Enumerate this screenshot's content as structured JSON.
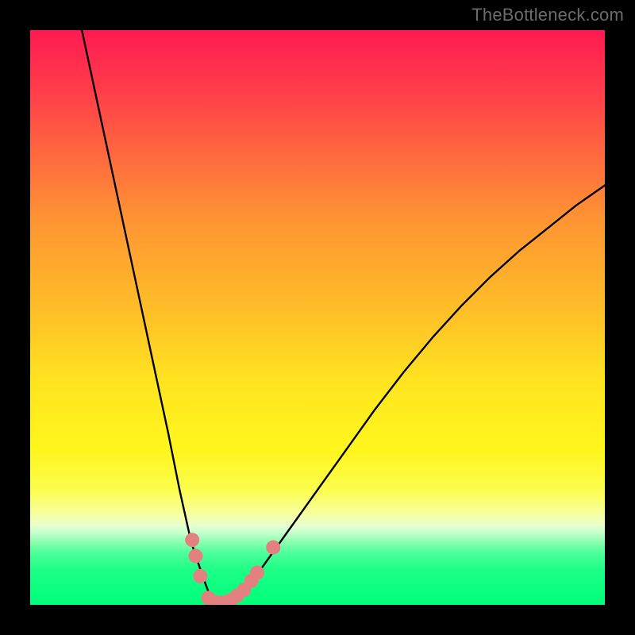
{
  "watermark": "TheBottleneck.com",
  "colors": {
    "background": "#000000",
    "gradient_top": "#ff1a52",
    "gradient_mid": "#ffe61f",
    "gradient_bottom": "#00ff7a",
    "curve": "#000000",
    "markers": "#e58080"
  },
  "chart_data": {
    "type": "line",
    "title": "",
    "xlabel": "",
    "ylabel": "",
    "xlim": [
      0,
      100
    ],
    "ylim": [
      0,
      100
    ],
    "series": [
      {
        "name": "bottleneck-curve",
        "x": [
          9,
          12,
          15,
          18,
          21,
          24,
          26,
          28,
          30,
          31.5,
          33,
          35,
          37,
          40,
          45,
          50,
          55,
          60,
          65,
          70,
          75,
          80,
          85,
          90,
          95,
          100
        ],
        "y": [
          100,
          86,
          72,
          58,
          44,
          30,
          20,
          11,
          5,
          1,
          0,
          0.5,
          2,
          6,
          13,
          20,
          27,
          34,
          40.5,
          46.5,
          52,
          57,
          61.5,
          65.5,
          69.5,
          73
        ]
      }
    ],
    "markers": {
      "name": "highlighted-points",
      "points": [
        {
          "x": 28.2,
          "y": 11.3
        },
        {
          "x": 28.8,
          "y": 8.5
        },
        {
          "x": 29.6,
          "y": 5.0
        },
        {
          "x": 31.0,
          "y": 1.2
        },
        {
          "x": 32.2,
          "y": 0.5
        },
        {
          "x": 33.5,
          "y": 0.4
        },
        {
          "x": 34.8,
          "y": 0.8
        },
        {
          "x": 36.0,
          "y": 1.6
        },
        {
          "x": 37.2,
          "y": 2.6
        },
        {
          "x": 38.5,
          "y": 4.2
        },
        {
          "x": 39.5,
          "y": 5.6
        },
        {
          "x": 42.3,
          "y": 10.0
        }
      ]
    },
    "legend": false,
    "grid": false
  }
}
